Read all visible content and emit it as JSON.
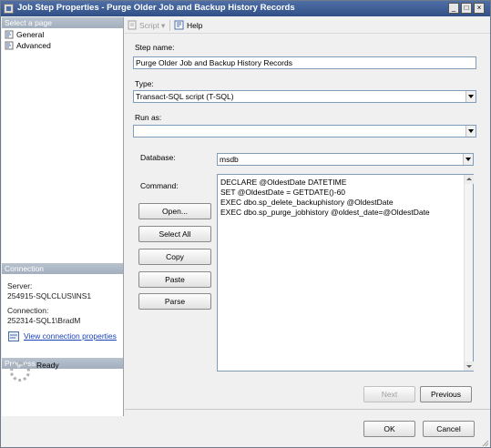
{
  "window": {
    "title": "Job Step Properties - Purge Older Job and Backup History Records",
    "minimize": "_",
    "maximize": "□",
    "close": "×"
  },
  "sidebar": {
    "select_page_header": "Select a page",
    "pages": [
      {
        "label": "General",
        "icon": "page-icon"
      },
      {
        "label": "Advanced",
        "icon": "page-icon"
      }
    ],
    "connection_header": "Connection",
    "server_label": "Server:",
    "server_value": "254915-SQLCLUS\\INS1",
    "connection_label": "Connection:",
    "connection_value": "252314-SQL1\\BradM",
    "view_connection_link": "View connection properties",
    "progress_header": "Progress",
    "progress_status": "Ready"
  },
  "toolbar": {
    "script_label": "Script",
    "help_label": "Help"
  },
  "form": {
    "step_name_label": "Step name:",
    "step_name_value": "Purge Older Job and Backup History Records",
    "type_label": "Type:",
    "type_value": "Transact-SQL script (T-SQL)",
    "run_as_label": "Run as:",
    "run_as_value": "",
    "database_label": "Database:",
    "database_value": "msdb",
    "command_label": "Command:",
    "command_lines": [
      "DECLARE @OldestDate DATETIME",
      "SET @OldestDate = GETDATE()-60",
      "EXEC dbo.sp_delete_backuphistory @OldestDate",
      "EXEC dbo.sp_purge_jobhistory @oldest_date=@OldestDate"
    ]
  },
  "buttons": {
    "open": "Open...",
    "select_all": "Select All",
    "copy": "Copy",
    "paste": "Paste",
    "parse": "Parse",
    "next": "Next",
    "previous": "Previous",
    "ok": "OK",
    "cancel": "Cancel"
  }
}
